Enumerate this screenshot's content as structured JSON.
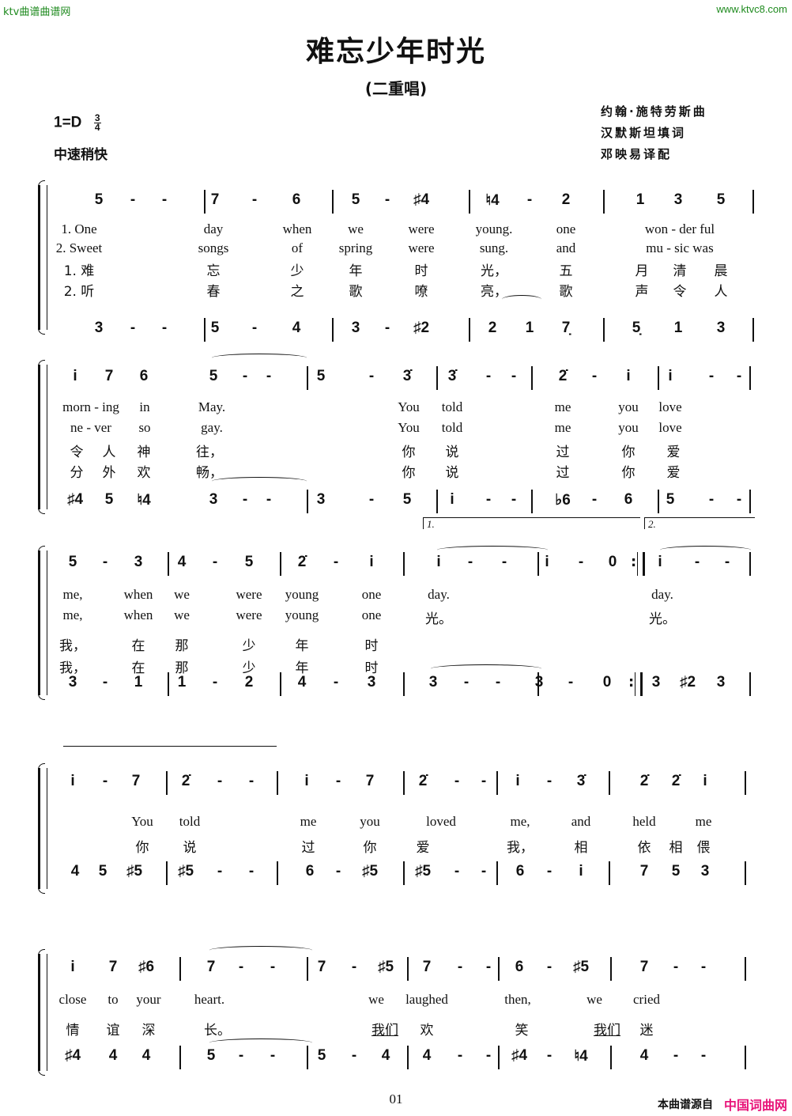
{
  "watermark": {
    "left": "ktv曲谱曲谱网",
    "right": "www.ktvc8.com",
    "color": "#1e8a1e"
  },
  "title": "难忘少年时光",
  "subtitle": "(二重唱)",
  "key": "1=D",
  "time_signature": {
    "top": "3",
    "bottom": "4"
  },
  "tempo": "中速稍快",
  "credits": [
    "约翰·施特劳斯曲",
    "汉默斯坦填词",
    "邓映易译配"
  ],
  "systems": [
    {
      "upper": [
        "5",
        "-",
        "-",
        "|",
        "7",
        "-",
        "6",
        "|",
        "5",
        "-",
        "♯4",
        "|",
        "♮4",
        "-",
        "2",
        "|",
        "1",
        "3",
        "5",
        "|"
      ],
      "lyrics_en1": [
        "1. One",
        "day",
        "when",
        "we",
        "were",
        "young.",
        "one",
        "won - der ful"
      ],
      "lyrics_en2": [
        "2. Sweet",
        "songs",
        "of",
        "spring",
        "were",
        "sung.",
        "and",
        "mu - sic was"
      ],
      "lyrics_cn1": [
        "1. 难",
        "忘",
        "少",
        "年",
        "时",
        "光，",
        "五",
        "月",
        "清",
        "晨"
      ],
      "lyrics_cn2": [
        "2. 听",
        "春",
        "之",
        "歌",
        "嘹",
        "亮，",
        "歌",
        "声",
        "令",
        "人"
      ],
      "lower": [
        "3",
        "-",
        "-",
        "|",
        "5",
        "-",
        "4",
        "|",
        "3",
        "-",
        "♯2",
        "|",
        "2",
        "1",
        "7̣",
        "|",
        "5̣",
        "1",
        "3",
        "|"
      ]
    },
    {
      "upper": [
        "i",
        "7",
        "6",
        "5",
        "-",
        "-",
        "|",
        "5",
        "-",
        "3̇",
        "|",
        "3̇",
        "-",
        "-",
        "|",
        "2̇",
        "-",
        "i",
        "|",
        "i",
        "-",
        "-",
        "|"
      ],
      "lyrics_en1": [
        "morn - ing",
        "in",
        "May.",
        "You",
        "told",
        "me",
        "you",
        "love"
      ],
      "lyrics_en2": [
        "ne - ver",
        "so",
        "gay.",
        "You",
        "told",
        "me",
        "you",
        "love"
      ],
      "lyrics_cn1": [
        "令",
        "人",
        "神",
        "往，",
        "你",
        "说",
        "过",
        "你",
        "爱"
      ],
      "lyrics_cn2": [
        "分",
        "外",
        "欢",
        "畅，",
        "你",
        "说",
        "过",
        "你",
        "爱"
      ],
      "lower": [
        "♯4",
        "5",
        "♮4",
        "3",
        "-",
        "-",
        "|",
        "3",
        "-",
        "5",
        "|",
        "i",
        "-",
        "-",
        "|",
        "♭6",
        "-",
        "6",
        "|",
        "5",
        "-",
        "-",
        "|"
      ]
    },
    {
      "volta1": "1.",
      "volta2": "2.",
      "upper": [
        "5",
        "-",
        "3",
        "|",
        "4",
        "-",
        "5",
        "|",
        "2̇",
        "-",
        "i",
        "|",
        "i",
        "-",
        "-",
        "|",
        "i",
        "-",
        "0",
        ":‖",
        "i",
        "-",
        "-"
      ],
      "lyrics_en1": [
        "me,",
        "when",
        "we",
        "were",
        "young",
        "one",
        "day.",
        "day."
      ],
      "lyrics_en2": [
        "me,",
        "when",
        "we",
        "were",
        "young",
        "one",
        "光。",
        "光。"
      ],
      "lyrics_cn1": [
        "我，",
        "在",
        "那",
        "少",
        "年",
        "时"
      ],
      "lyrics_cn2": [
        "我，",
        "在",
        "那",
        "少",
        "年",
        "时"
      ],
      "lower": [
        "3",
        "-",
        "1",
        "|",
        "1",
        "-",
        "2",
        "|",
        "4",
        "-",
        "3",
        "|",
        "3",
        "-",
        "-",
        "|",
        "3",
        "-",
        "0",
        ":‖",
        "3",
        "♯2",
        "3"
      ]
    },
    {
      "upper": [
        "i",
        "-",
        "7",
        "|",
        "2̇",
        "-",
        "-",
        "|",
        "i",
        "-",
        "7",
        "|",
        "2̇",
        "-",
        "-",
        "|",
        "i",
        "-",
        "3̇",
        "|",
        "2̇",
        "2̇",
        "i",
        "|"
      ],
      "lyrics_en1": [
        "You",
        "told",
        "me",
        "you",
        "loved",
        "me,",
        "and",
        "held",
        "me"
      ],
      "lyrics_cn1": [
        "你",
        "说",
        "过",
        "你",
        "爱",
        "我，",
        "相",
        "依",
        "相",
        "偎"
      ],
      "lower": [
        "4",
        "5",
        "♯5",
        "|",
        "♯5",
        "-",
        "-",
        "|",
        "6",
        "-",
        "♯5",
        "|",
        "♯5",
        "-",
        "-",
        "|",
        "6",
        "-",
        "i",
        "|",
        "7",
        "5",
        "3",
        "|"
      ]
    },
    {
      "upper": [
        "i",
        "7",
        "♯6",
        "|",
        "7",
        "-",
        "-",
        "|",
        "7",
        "-",
        "♯5",
        "|",
        "7",
        "-",
        "-",
        "|",
        "6",
        "-",
        "♯5",
        "|",
        "7",
        "-",
        "-",
        "|"
      ],
      "lyrics_en1": [
        "close",
        "to",
        "your",
        "heart.",
        "we",
        "laughed",
        "then,",
        "we",
        "cried"
      ],
      "lyrics_cn1": [
        "情",
        "谊",
        "深",
        "长。",
        "我们",
        "欢",
        "笑",
        "我们",
        "迷"
      ],
      "lower": [
        "♯4",
        "4",
        "4",
        "|",
        "5",
        "-",
        "-",
        "|",
        "5",
        "-",
        "4",
        "|",
        "4",
        "-",
        "-",
        "|",
        "♯4",
        "-",
        "♮4",
        "|",
        "4",
        "-",
        "-",
        "|"
      ]
    }
  ],
  "page_number": "01",
  "source": {
    "label": "本曲谱源自",
    "site": "中国词曲网",
    "site_color": "#e8157a"
  }
}
